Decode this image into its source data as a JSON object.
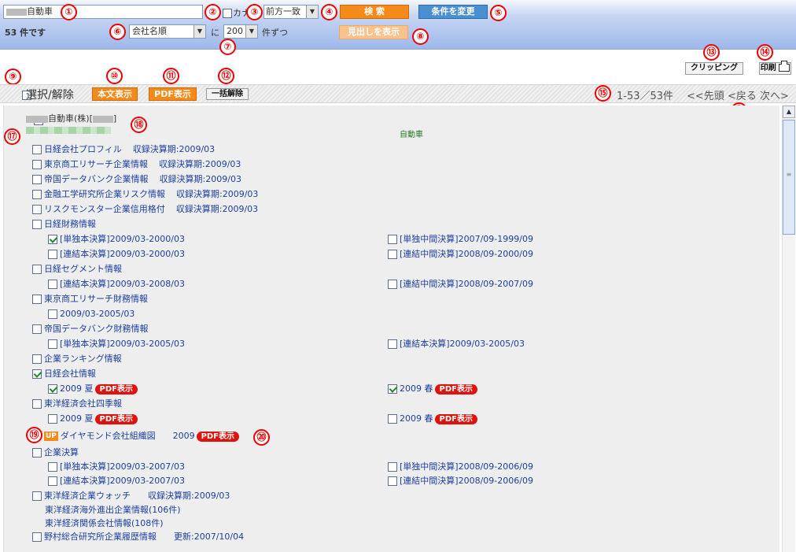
{
  "search": {
    "value": "自動車",
    "kana_label": "カナ",
    "match_value": "前方一致",
    "search_button": "検 索",
    "change_button": "条件を変更"
  },
  "results": {
    "count_text": "53 件です",
    "sort_value": "会社名順",
    "ni": "に",
    "per_page": "200",
    "per_unit": "件ずつ",
    "headline_button": "見出しを表示"
  },
  "tools": {
    "clipping": "クリッピング",
    "print": "印刷"
  },
  "bar": {
    "select_label": "選択/解除",
    "body_button": "本文表示",
    "pdf_button": "PDF表示",
    "clear_button": "一括解除",
    "range": "1-53／53件",
    "first": "<<先頭",
    "prev": "<戻る",
    "next": "次へ>"
  },
  "company": {
    "name_suffix": "自動車(株)[",
    "name_close": "]",
    "industry": "自動車"
  },
  "items": [
    {
      "label": "日経会社プロフィル",
      "period": "収録決算期:2009/03"
    },
    {
      "label": "東京商工リサーチ企業情報",
      "period": "収録決算期:2009/03"
    },
    {
      "label": "帝国データバンク企業情報",
      "period": "収録決算期:2009/03"
    },
    {
      "label": "金融工学研究所企業リスク情報",
      "period": "収録決算期:2009/03"
    },
    {
      "label": "リスクモンスター企業信用格付",
      "period": "収録決算期:2009/03"
    },
    {
      "label": "日経財務情報"
    },
    {
      "label": "[単独本決算]2009/03-2000/03"
    },
    {
      "label": "[単独中間決算]2007/09-1999/09"
    },
    {
      "label": "[連結本決算]2009/03-2000/03"
    },
    {
      "label": "[連結中間決算]2008/09-2000/09"
    },
    {
      "label": "日経セグメント情報"
    },
    {
      "label": "[連結本決算]2009/03-2008/03"
    },
    {
      "label": "[連結中間決算]2008/09-2007/09"
    },
    {
      "label": "東京商工リサーチ財務情報"
    },
    {
      "label": "2009/03-2005/03"
    },
    {
      "label": "帝国データバンク財務情報"
    },
    {
      "label": "[単独本決算]2009/03-2005/03"
    },
    {
      "label": "[連結本決算]2009/03-2005/03"
    },
    {
      "label": "企業ランキング情報"
    },
    {
      "label": "日経会社情報"
    },
    {
      "label": "2009 夏"
    },
    {
      "label": "2009 春"
    },
    {
      "label": "東洋経済会社四季報"
    },
    {
      "label": "2009 夏"
    },
    {
      "label": "2009 春"
    },
    {
      "label": "ダイヤモンド会社組織図",
      "year": "2009",
      "up": "UP"
    },
    {
      "label": "企業決算"
    },
    {
      "label": "[単独本決算]2009/03-2007/03"
    },
    {
      "label": "[単独中間決算]2008/09-2006/09"
    },
    {
      "label": "[連結本決算]2009/03-2007/03"
    },
    {
      "label": "[連結中間決算]2008/09-2006/09"
    },
    {
      "label": "東洋経済企業ウォッチ",
      "period": "収録決算期:2009/03"
    },
    {
      "label": "東洋経済海外進出企業情報(106件)"
    },
    {
      "label": "東洋経済関係会社情報(108件)"
    },
    {
      "label": "野村総合研究所企業履歴情報",
      "period": "更新:2007/10/04"
    }
  ],
  "pdf_badge": "PDF表示",
  "callouts": [
    "①",
    "②",
    "③",
    "④",
    "⑤",
    "⑥",
    "⑦",
    "⑧",
    "⑨",
    "⑩",
    "⑪",
    "⑫",
    "⑬",
    "⑭",
    "⑮",
    "⑯",
    "⑰",
    "⑱",
    "⑲",
    "⑳"
  ],
  "colors": {
    "header_band": "#9db8ea",
    "accent_orange": "#f38a1a",
    "change_button": "#4a8fd0",
    "pdf_red": "#e0120e",
    "link": "#1a3fa0"
  }
}
